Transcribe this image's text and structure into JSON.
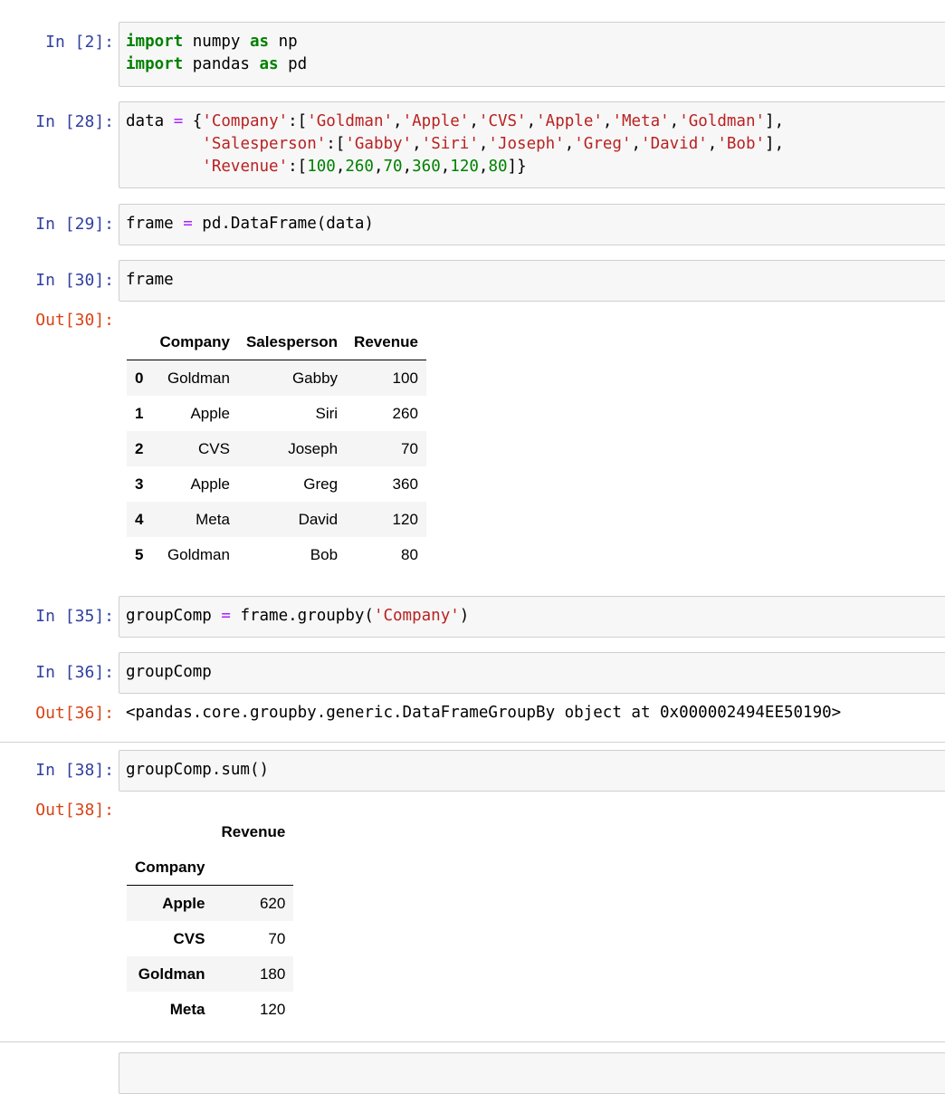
{
  "cells": {
    "c2": {
      "prompt": "In [2]:"
    },
    "c28": {
      "prompt": "In [28]:"
    },
    "c29": {
      "prompt": "In [29]:"
    },
    "c30": {
      "prompt": "In [30]:",
      "out_prompt": "Out[30]:"
    },
    "c35": {
      "prompt": "In [35]:"
    },
    "c36": {
      "prompt": "In [36]:",
      "out_prompt": "Out[36]:",
      "output": "<pandas.core.groupby.generic.DataFrameGroupBy object at 0x000002494EE50190>"
    },
    "c38": {
      "prompt": "In [38]:",
      "out_prompt": "Out[38]:"
    }
  },
  "code": {
    "l1_kw1": "import",
    "l1_mod": " numpy ",
    "l1_kw2": "as",
    "l1_alias": " np",
    "l2_kw1": "import",
    "l2_mod": " pandas ",
    "l2_kw2": "as",
    "l2_alias": " pd",
    "c28_var": "data ",
    "c28_eq": "=",
    "c28_open": " {",
    "s_company": "'Company'",
    "s_goldman": "'Goldman'",
    "s_apple": "'Apple'",
    "s_cvs": "'CVS'",
    "s_meta": "'Meta'",
    "s_salesperson": "'Salesperson'",
    "s_gabby": "'Gabby'",
    "s_siri": "'Siri'",
    "s_joseph": "'Joseph'",
    "s_greg": "'Greg'",
    "s_david": "'David'",
    "s_bob": "'Bob'",
    "s_revenue": "'Revenue'",
    "n100": "100",
    "n260": "260",
    "n70": "70",
    "n360": "360",
    "n120": "120",
    "n80": "80",
    "c29_var": "frame ",
    "c29_eq": "=",
    "c29_rest": " pd.DataFrame(data)",
    "c30_src": "frame",
    "c35_var": "groupComp ",
    "c35_eq": "=",
    "c35_call": " frame.groupby(",
    "c35_arg": "'Company'",
    "c35_close": ")",
    "c36_src": "groupComp",
    "c38_src": "groupComp.sum()"
  },
  "frame_table": {
    "headers": [
      "",
      "Company",
      "Salesperson",
      "Revenue"
    ],
    "rows": [
      [
        "0",
        "Goldman",
        "Gabby",
        "100"
      ],
      [
        "1",
        "Apple",
        "Siri",
        "260"
      ],
      [
        "2",
        "CVS",
        "Joseph",
        "70"
      ],
      [
        "3",
        "Apple",
        "Greg",
        "360"
      ],
      [
        "4",
        "Meta",
        "David",
        "120"
      ],
      [
        "5",
        "Goldman",
        "Bob",
        "80"
      ]
    ]
  },
  "sum_table": {
    "column": "Revenue",
    "index_name": "Company",
    "rows": [
      [
        "Apple",
        "620"
      ],
      [
        "CVS",
        "70"
      ],
      [
        "Goldman",
        "180"
      ],
      [
        "Meta",
        "120"
      ]
    ]
  }
}
